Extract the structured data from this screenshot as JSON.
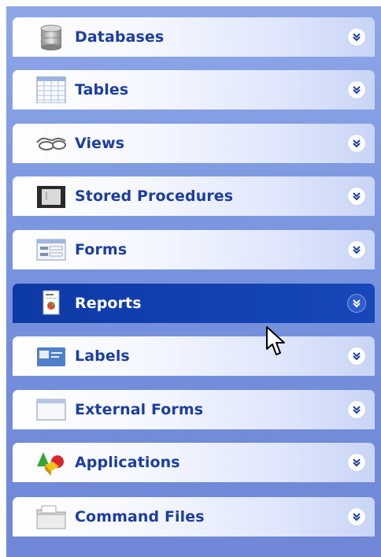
{
  "panel": {
    "items": [
      {
        "label": "Databases",
        "icon": "database-icon",
        "active": false
      },
      {
        "label": "Tables",
        "icon": "table-icon",
        "active": false
      },
      {
        "label": "Views",
        "icon": "glasses-icon",
        "active": false
      },
      {
        "label": "Stored Procedures",
        "icon": "stored-procedure-icon",
        "active": false
      },
      {
        "label": "Forms",
        "icon": "form-icon",
        "active": false
      },
      {
        "label": "Reports",
        "icon": "report-icon",
        "active": true
      },
      {
        "label": "Labels",
        "icon": "label-icon",
        "active": false
      },
      {
        "label": "External Forms",
        "icon": "window-icon",
        "active": false
      },
      {
        "label": "Applications",
        "icon": "shapes-icon",
        "active": false
      },
      {
        "label": "Command Files",
        "icon": "folder-icon",
        "active": false
      }
    ],
    "expand_icon": "chevron-double-down-icon",
    "cursor_icon": "mouse-pointer-icon"
  }
}
